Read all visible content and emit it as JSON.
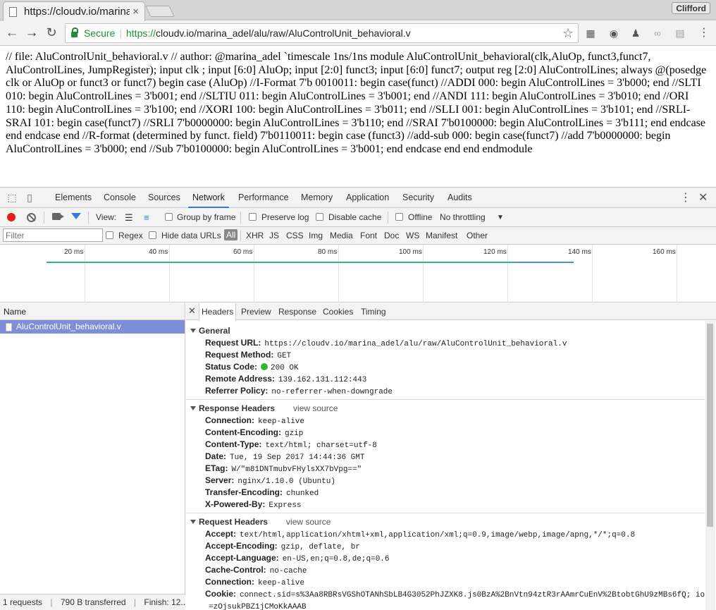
{
  "browser": {
    "tab_title": "https://cloudv.io/marina_adel/alu/raw/AluControlUnit_behavioral.v",
    "tab_close": "×",
    "profile_name": "Clifford",
    "secure_label": "Secure",
    "url_scheme": "https://",
    "url_rest": "cloudv.io/marina_adel/alu/raw/AluControlUnit_behavioral.v"
  },
  "page": {
    "text": "// file: AluControlUnit_behavioral.v // author: @marina_adel `timescale 1ns/1ns module AluControlUnit_behavioral(clk,AluOp, funct3,funct7, AluControlLines, JumpRegister); input clk ; input [6:0] AluOp; input [2:0] funct3; input [6:0] funct7; output reg [2:0] AluControlLines; always @(posedge clk or AluOp or funct3 or funct7) begin case (AluOp) //I-Format 7'b 0010011: begin case(funct) //ADDI 000: begin AluControlLines = 3'b000; end //SLTI 010: begin AluControlLines = 3'b001; end //SLTIU 011: begin AluControlLines = 3'b001; end //ANDI 111: begin AluControlLines = 3'b010; end //ORI 110: begin AluControlLines = 3'b100; end //XORI 100: begin AluControlLines = 3'b011; end //SLLI 001: begin AluControlLines = 3'b101; end //SRLI-SRAI 101: begin case(funct7) //SRLI 7'b0000000: begin AluControlLines = 3'b110; end //SRAI 7'b0100000: begin AluControlLines = 3'b111; end endcase end endcase end //R-format (determined by funct. field) 7'b0110011: begin case (funct3) //add-sub 000: begin case(funct7) //add 7'b0000000: begin AluControlLines = 3'b000; end //Sub 7'b0100000: begin AluControlLines = 3'b001; end endcase end end endmodule"
  },
  "devtools": {
    "tabs": [
      "Elements",
      "Console",
      "Sources",
      "Network",
      "Performance",
      "Memory",
      "Application",
      "Security",
      "Audits"
    ],
    "active_tab": "Network",
    "toolbar": {
      "view_label": "View:",
      "group_by_frame": "Group by frame",
      "preserve_log": "Preserve log",
      "disable_cache": "Disable cache",
      "offline": "Offline",
      "throttling": "No throttling"
    },
    "filter": {
      "placeholder": "Filter",
      "regex": "Regex",
      "hide_data_urls": "Hide data URLs",
      "types": [
        "All",
        "XHR",
        "JS",
        "CSS",
        "Img",
        "Media",
        "Font",
        "Doc",
        "WS",
        "Manifest",
        "Other"
      ]
    },
    "timeline_ticks": [
      "20 ms",
      "40 ms",
      "60 ms",
      "80 ms",
      "100 ms",
      "120 ms",
      "140 ms",
      "160 ms"
    ],
    "name_header": "Name",
    "requests": [
      "AluControlUnit_behavioral.v"
    ],
    "status": {
      "requests": "1 requests",
      "transferred": "790 B transferred",
      "finish": "Finish: 12..."
    },
    "detail_tabs": [
      "Headers",
      "Preview",
      "Response",
      "Cookies",
      "Timing"
    ],
    "general": {
      "title": "General",
      "rows": [
        {
          "k": "Request URL:",
          "v": "https://cloudv.io/marina_adel/alu/raw/AluControlUnit_behavioral.v"
        },
        {
          "k": "Request Method:",
          "v": "GET"
        },
        {
          "k": "Status Code:",
          "v": "200 OK"
        },
        {
          "k": "Remote Address:",
          "v": "139.162.131.112:443"
        },
        {
          "k": "Referrer Policy:",
          "v": "no-referrer-when-downgrade"
        }
      ]
    },
    "response_headers": {
      "title": "Response Headers",
      "view_source": "view source",
      "rows": [
        {
          "k": "Connection:",
          "v": "keep-alive"
        },
        {
          "k": "Content-Encoding:",
          "v": "gzip"
        },
        {
          "k": "Content-Type:",
          "v": "text/html; charset=utf-8"
        },
        {
          "k": "Date:",
          "v": "Tue, 19 Sep 2017 14:44:36 GMT"
        },
        {
          "k": "ETag:",
          "v": "W/\"m81DNTmubvFHylsXX7bVpg==\""
        },
        {
          "k": "Server:",
          "v": "nginx/1.10.0 (Ubuntu)"
        },
        {
          "k": "Transfer-Encoding:",
          "v": "chunked"
        },
        {
          "k": "X-Powered-By:",
          "v": "Express"
        }
      ]
    },
    "request_headers": {
      "title": "Request Headers",
      "view_source": "view source",
      "rows": [
        {
          "k": "Accept:",
          "v": "text/html,application/xhtml+xml,application/xml;q=0.9,image/webp,image/apng,*/*;q=0.8"
        },
        {
          "k": "Accept-Encoding:",
          "v": "gzip, deflate, br"
        },
        {
          "k": "Accept-Language:",
          "v": "en-US,en;q=0.8,de;q=0.6"
        },
        {
          "k": "Cache-Control:",
          "v": "no-cache"
        },
        {
          "k": "Connection:",
          "v": "keep-alive"
        },
        {
          "k": "Cookie:",
          "v": "connect.sid=s%3Aa8RBRsVGShOTANhSbLB4G3052PhJZXK8.js0BzA%2BnVtn94ztR3rAAmrCuEnV%2BtobtGhU9zMBs6fQ; io"
        },
        {
          "k": "",
          "v": "=zOjsukPBZ1jCMoKkAAAB"
        }
      ]
    }
  }
}
